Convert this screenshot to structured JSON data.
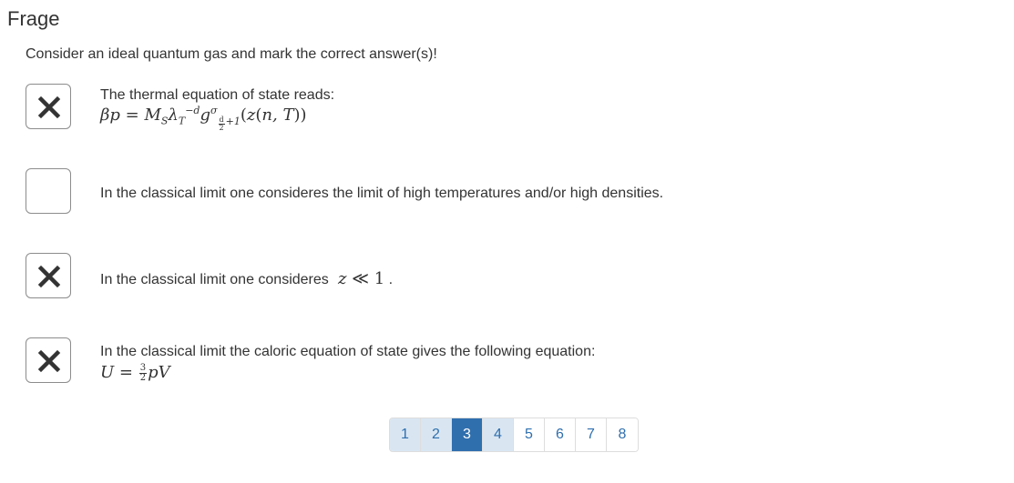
{
  "page": {
    "title": "Frage"
  },
  "question": {
    "prompt": "Consider an ideal quantum gas and mark the correct answer(s)!"
  },
  "answers": [
    {
      "checked": true,
      "text": "The thermal equation of state reads:",
      "formula": "βp = M_S λ_T^{-d} g^σ_{d/2+1}(z(n,T))"
    },
    {
      "checked": false,
      "text": "In the classical limit one consideres the limit of high temperatures and/or high densities."
    },
    {
      "checked": true,
      "text": "In the classical limit one consideres",
      "formula": "z ≪ 1",
      "suffix": "."
    },
    {
      "checked": true,
      "text": "In the classical limit the caloric equation of state gives the following equation:",
      "formula": "U = 3/2 pV"
    }
  ],
  "pagination": {
    "pages": [
      "1",
      "2",
      "3",
      "4",
      "5",
      "6",
      "7",
      "8"
    ],
    "current": "3"
  },
  "icons": {
    "checked": "x-mark-icon"
  },
  "colors": {
    "link": "#2f6fae",
    "active_bg": "#2f6fae",
    "visited_bg": "#d9e6f2"
  }
}
